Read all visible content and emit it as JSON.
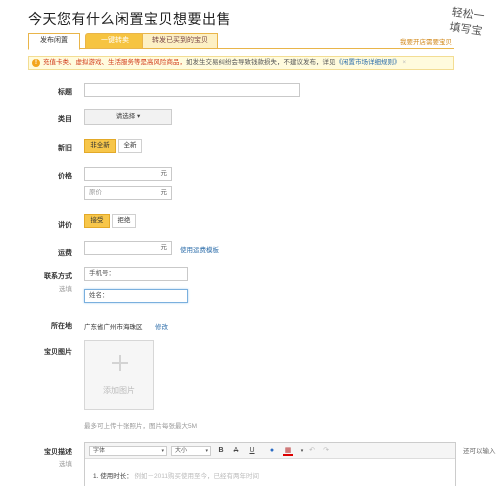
{
  "page": {
    "title": "今天您有什么闲置宝贝想要出售",
    "handwriting": "轻松一\n填写宝"
  },
  "tabs": [
    {
      "label": "发布闲置"
    },
    {
      "label": "一键转卖"
    },
    {
      "label": "转发已买到的宝贝"
    }
  ],
  "tab_link": "我要开店需要宝贝",
  "warning": {
    "icon": "!",
    "red_text": "充值卡类、虚拟游戏、生活服务等是高风险商品，",
    "normal_text": "如发生交易纠纷会导致钱款损失，不建议发布，详见",
    "link_text": "《闲置市场详细规则》",
    "tail": "×"
  },
  "form": {
    "title_label": "标题",
    "category_label": "类目",
    "category_select": "请选择",
    "category_caret": "▾",
    "condition_label": "新旧",
    "condition_options": [
      "非全新",
      "全新"
    ],
    "price_label": "价格",
    "price_unit": "元",
    "orig_price_placeholder": "原价",
    "orig_price_unit": "元",
    "negotiable_label": "讲价",
    "negotiable_options": [
      "接受",
      "拒绝"
    ],
    "shipping_label": "运费",
    "shipping_unit": "元",
    "shipping_link": "使用运费模板",
    "contact_label": "联系方式",
    "contact_sub": "选填",
    "phone_placeholder": "手机号：",
    "name_placeholder": "姓名：",
    "location_label": "所在地",
    "location_value": "广东省广州市海珠区",
    "location_link": "修改",
    "image_label": "宝贝图片",
    "upload_label": "添加图片",
    "upload_hint": "最多可上传十张照片，图片每张最大5M",
    "desc_label": "宝贝描述",
    "desc_sub": "选填"
  },
  "editor": {
    "font_select": "字体",
    "size_select": "大小",
    "bold": "B",
    "strike": "A",
    "underline": "U",
    "color_icon": "●",
    "table_icon": "▦",
    "undo": "↶",
    "redo": "↷",
    "body_prefix": "1. 使用时长：",
    "body_placeholder": "例如－2011购买使用至今，已经有两年时间",
    "right_note": "还可以输入"
  },
  "colors": {
    "accent": "#f6c441",
    "border": "#e9b54a",
    "link": "#2f6fab",
    "warning_red": "#d23b1b"
  }
}
